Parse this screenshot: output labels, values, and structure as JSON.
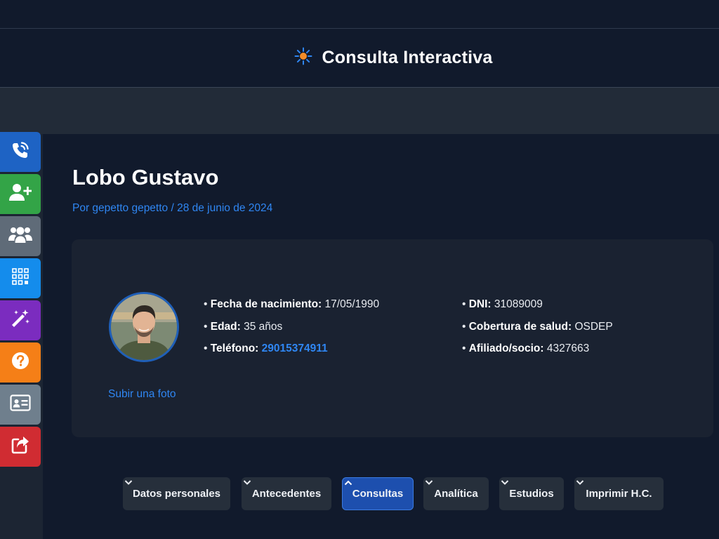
{
  "header": {
    "title": "Consulta Interactiva",
    "logo_icon": "sun-logo-icon"
  },
  "sidebar": {
    "items": [
      {
        "icon": "phone-call-icon",
        "color": "#1e63c4"
      },
      {
        "icon": "add-user-icon",
        "color": "#33a447"
      },
      {
        "icon": "users-group-icon",
        "color": "#5f6b78"
      },
      {
        "icon": "grid-icon",
        "color": "#148cec"
      },
      {
        "icon": "magic-wand-icon",
        "color": "#7b2cbf"
      },
      {
        "icon": "help-icon",
        "color": "#f57f17"
      },
      {
        "icon": "id-card-icon",
        "color": "#6f7f8d"
      },
      {
        "icon": "share-icon",
        "color": "#d02c32"
      }
    ]
  },
  "patient": {
    "name": "Lobo Gustavo",
    "byline": "Por gepetto gepetto / 28 de junio de 2024",
    "upload_photo": "Subir una foto",
    "info_left": [
      {
        "label": "Fecha de nacimiento:",
        "value": "17/05/1990"
      },
      {
        "label": "Edad:",
        "value": "35 años"
      },
      {
        "label": "Teléfono:",
        "value": "29015374911"
      }
    ],
    "info_right": [
      {
        "label": "DNI:",
        "value": "31089009"
      },
      {
        "label": "Cobertura de salud:",
        "value": "OSDEP"
      },
      {
        "label": "Afiliado/socio:",
        "value": "4327663"
      }
    ]
  },
  "tabs": [
    {
      "label": "Datos personales",
      "active": false
    },
    {
      "label": "Antecedentes",
      "active": false
    },
    {
      "label": "Consultas",
      "active": true
    },
    {
      "label": "Analítica",
      "active": false
    },
    {
      "label": "Estudios",
      "active": false
    },
    {
      "label": "Imprimir H.C.",
      "active": false
    }
  ]
}
